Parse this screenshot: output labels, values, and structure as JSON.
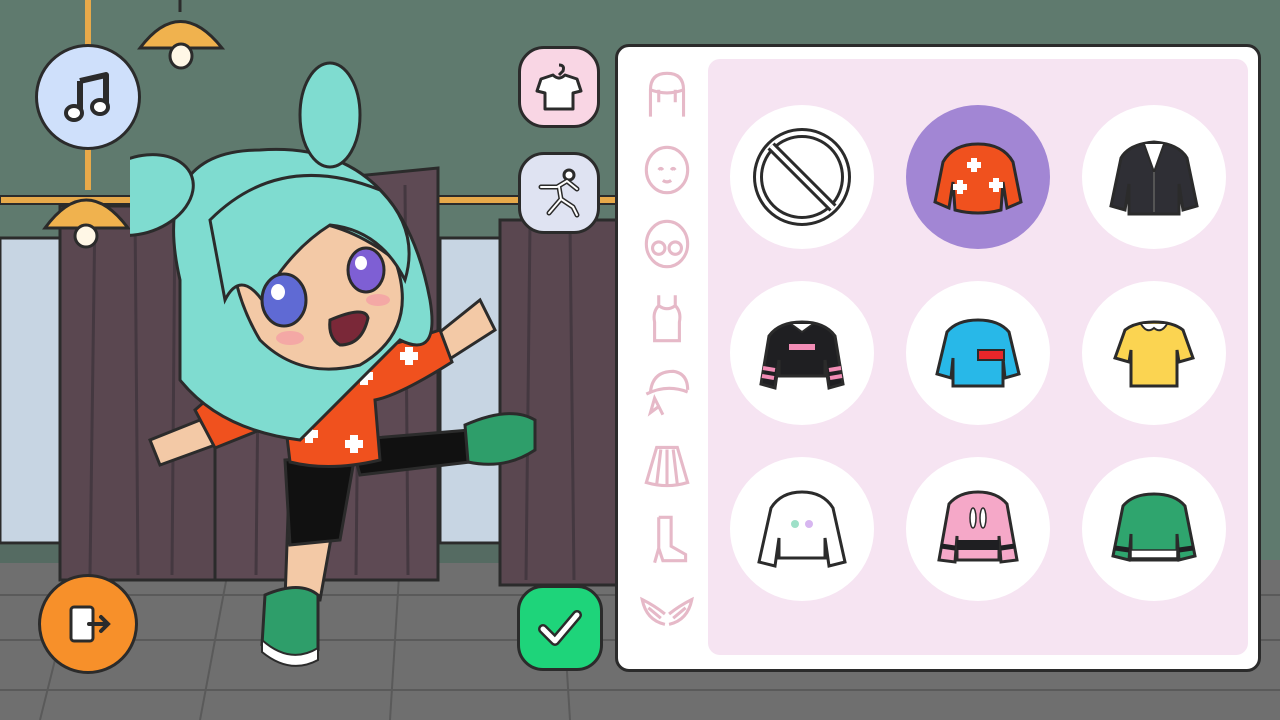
{
  "ui": {
    "music_button": "music-icon",
    "exit_button": "exit-icon",
    "outfit_mode_button": "hanger-shirt-icon",
    "pose_mode_button": "pose-figure-icon",
    "confirm_button": "checkmark-icon"
  },
  "categories": [
    {
      "icon": "hair-icon"
    },
    {
      "icon": "face-icon"
    },
    {
      "icon": "glasses-icon"
    },
    {
      "icon": "tank-top-icon"
    },
    {
      "icon": "hat-icon"
    },
    {
      "icon": "skirt-icon"
    },
    {
      "icon": "boot-icon"
    },
    {
      "icon": "wings-icon"
    }
  ],
  "items": [
    {
      "icon": "none-icon",
      "selected": false
    },
    {
      "icon": "orange-cross-sweater-icon",
      "selected": true
    },
    {
      "icon": "pinstripe-blazer-icon",
      "selected": false
    },
    {
      "icon": "black-pink-crop-top-icon",
      "selected": false
    },
    {
      "icon": "blue-red-shirt-icon",
      "selected": false
    },
    {
      "icon": "yellow-collar-shirt-icon",
      "selected": false
    },
    {
      "icon": "white-heart-sweater-icon",
      "selected": false
    },
    {
      "icon": "pink-bunny-hoodie-icon",
      "selected": false
    },
    {
      "icon": "green-sweater-icon",
      "selected": false
    }
  ],
  "colors": {
    "wall": "#5f7a6e",
    "floor": "#6f6f6f",
    "curtain": "#5a4750",
    "panel_bg": "#f6e4f2",
    "selected_item": "#a286d4",
    "confirm": "#1ed47a",
    "exit": "#f7902a",
    "music": "#cfe0fb",
    "outfit_mode": "#f9d6e4",
    "pose_mode": "#dfe3f2",
    "hair": "#7fdcd0",
    "sweater": "#f0511e"
  }
}
